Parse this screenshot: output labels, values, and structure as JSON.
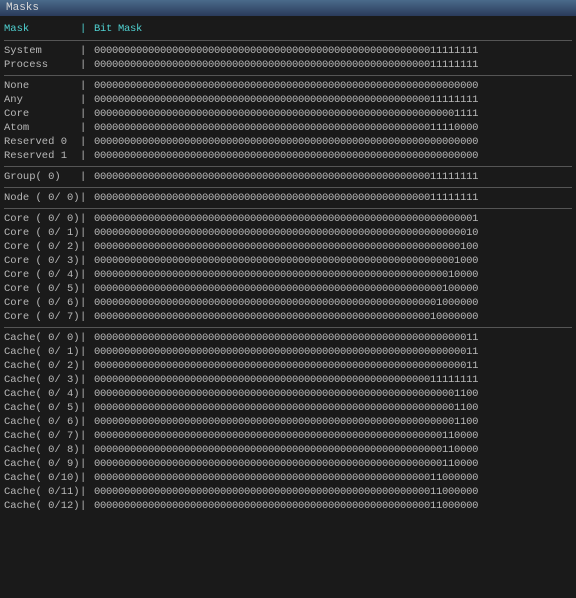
{
  "window": {
    "title": "Masks"
  },
  "table": {
    "header": {
      "col1": "Mask",
      "col2": "Bit Mask"
    },
    "groups": [
      {
        "rows": [
          {
            "label": "System",
            "bits": "0000000000000000000000000000000000000000000000000000000011111111"
          },
          {
            "label": "Process",
            "bits": "0000000000000000000000000000000000000000000000000000000011111111"
          }
        ]
      },
      {
        "rows": [
          {
            "label": "None",
            "bits": "0000000000000000000000000000000000000000000000000000000000000000"
          },
          {
            "label": "Any",
            "bits": "0000000000000000000000000000000000000000000000000000000011111111"
          },
          {
            "label": "Core",
            "bits": "0000000000000000000000000000000000000000000000000000000000001111"
          },
          {
            "label": "Atom",
            "bits": "0000000000000000000000000000000000000000000000000000000011110000"
          },
          {
            "label": "Reserved 0",
            "bits": "0000000000000000000000000000000000000000000000000000000000000000"
          },
          {
            "label": "Reserved 1",
            "bits": "0000000000000000000000000000000000000000000000000000000000000000"
          }
        ]
      },
      {
        "rows": [
          {
            "label": "Group( 0)",
            "bits": "0000000000000000000000000000000000000000000000000000000011111111"
          }
        ]
      },
      {
        "rows": [
          {
            "label": "Node ( 0/ 0)",
            "bits": "0000000000000000000000000000000000000000000000000000000011111111"
          }
        ]
      },
      {
        "rows": [
          {
            "label": "Core ( 0/ 0)",
            "bits": "0000000000000000000000000000000000000000000000000000000000000001"
          },
          {
            "label": "Core ( 0/ 1)",
            "bits": "0000000000000000000000000000000000000000000000000000000000000010"
          },
          {
            "label": "Core ( 0/ 2)",
            "bits": "0000000000000000000000000000000000000000000000000000000000000100"
          },
          {
            "label": "Core ( 0/ 3)",
            "bits": "0000000000000000000000000000000000000000000000000000000000001000"
          },
          {
            "label": "Core ( 0/ 4)",
            "bits": "0000000000000000000000000000000000000000000000000000000000010000"
          },
          {
            "label": "Core ( 0/ 5)",
            "bits": "0000000000000000000000000000000000000000000000000000000000100000"
          },
          {
            "label": "Core ( 0/ 6)",
            "bits": "0000000000000000000000000000000000000000000000000000000001000000"
          },
          {
            "label": "Core ( 0/ 7)",
            "bits": "0000000000000000000000000000000000000000000000000000000010000000"
          }
        ]
      },
      {
        "rows": [
          {
            "label": "Cache( 0/ 0)",
            "bits": "0000000000000000000000000000000000000000000000000000000000000011"
          },
          {
            "label": "Cache( 0/ 1)",
            "bits": "0000000000000000000000000000000000000000000000000000000000000011"
          },
          {
            "label": "Cache( 0/ 2)",
            "bits": "0000000000000000000000000000000000000000000000000000000000000011"
          },
          {
            "label": "Cache( 0/ 3)",
            "bits": "0000000000000000000000000000000000000000000000000000000011111111"
          },
          {
            "label": "Cache( 0/ 4)",
            "bits": "0000000000000000000000000000000000000000000000000000000000001100"
          },
          {
            "label": "Cache( 0/ 5)",
            "bits": "0000000000000000000000000000000000000000000000000000000000001100"
          },
          {
            "label": "Cache( 0/ 6)",
            "bits": "0000000000000000000000000000000000000000000000000000000000001100"
          },
          {
            "label": "Cache( 0/ 7)",
            "bits": "0000000000000000000000000000000000000000000000000000000000110000"
          },
          {
            "label": "Cache( 0/ 8)",
            "bits": "0000000000000000000000000000000000000000000000000000000000110000"
          },
          {
            "label": "Cache( 0/ 9)",
            "bits": "0000000000000000000000000000000000000000000000000000000000110000"
          },
          {
            "label": "Cache( 0/10)",
            "bits": "0000000000000000000000000000000000000000000000000000000011000000"
          },
          {
            "label": "Cache( 0/11)",
            "bits": "0000000000000000000000000000000000000000000000000000000011000000"
          },
          {
            "label": "Cache( 0/12)",
            "bits": "0000000000000000000000000000000000000000000000000000000011000000"
          }
        ]
      }
    ]
  }
}
